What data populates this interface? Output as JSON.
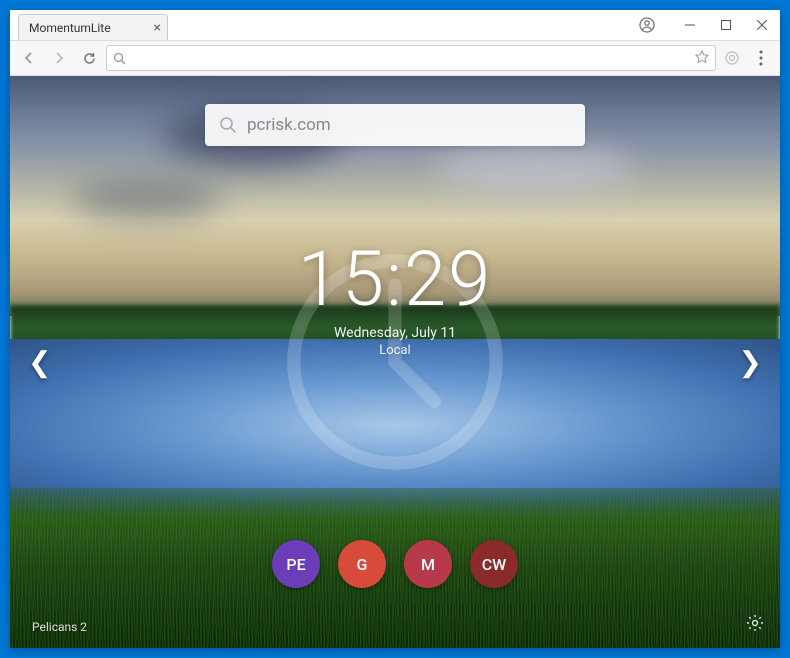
{
  "tab": {
    "title": "MomentumLite"
  },
  "search": {
    "value": "pcrisk.com"
  },
  "clock": {
    "time": "15:29",
    "date": "Wednesday, July 11",
    "tz": "Local"
  },
  "shortcuts": [
    {
      "label": "PE",
      "color": "#6b3db8"
    },
    {
      "label": "G",
      "color": "#d84a3a"
    },
    {
      "label": "M",
      "color": "#b83a4a"
    },
    {
      "label": "CW",
      "color": "#8a2a2a"
    }
  ],
  "background": {
    "caption": "Pelicans 2"
  }
}
